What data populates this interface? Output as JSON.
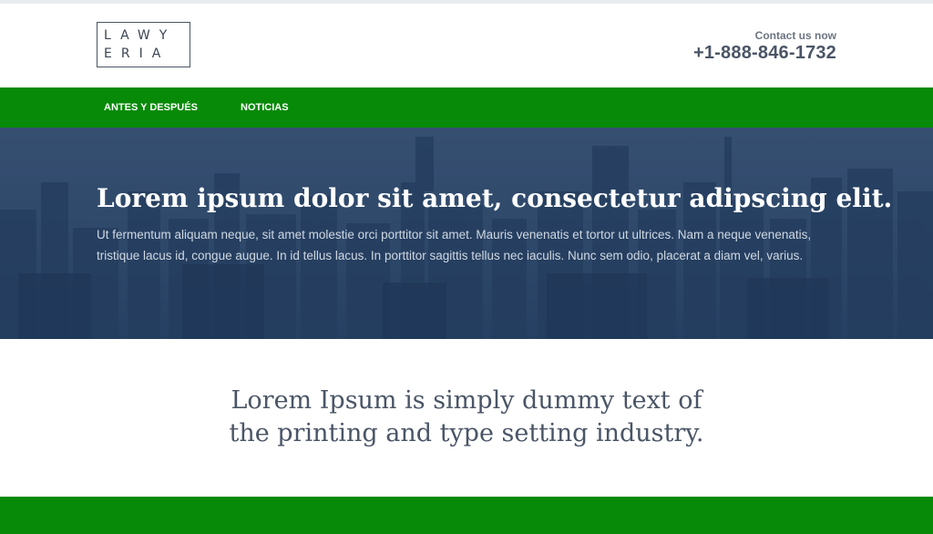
{
  "header": {
    "logo_line1": "LAWY",
    "logo_line2": "ERIA",
    "contact_label": "Contact us now",
    "phone": "+1-888-846-1732"
  },
  "nav": {
    "items": [
      {
        "label": "ANTES Y DESPUÉS"
      },
      {
        "label": "NOTICIAS"
      }
    ]
  },
  "hero": {
    "title": "Lorem ipsum dolor sit amet, consectetur adipscing elit.",
    "text": "Ut fermentum aliquam neque, sit amet molestie orci porttitor sit amet. Mauris venenatis et tortor ut ultrices. Nam a neque venenatis, tristique lacus id, congue augue. In id tellus lacus. In porttitor sagittis tellus nec iaculis. Nunc sem odio, placerat a diam vel, varius."
  },
  "tagline": {
    "line1": "Lorem Ipsum is simply dummy text of",
    "line2": "the printing and type setting industry."
  },
  "colors": {
    "accent_green": "#078a07",
    "hero_overlay": "#1c3458",
    "text_dark": "#4a5566"
  }
}
